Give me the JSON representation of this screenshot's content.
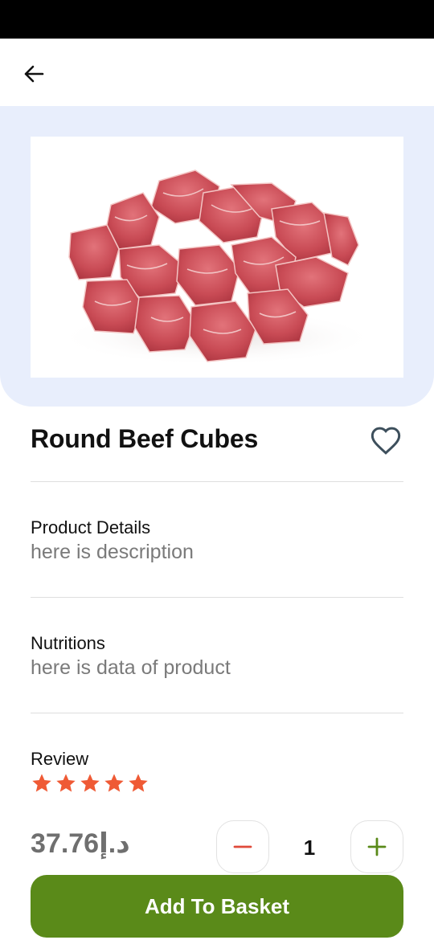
{
  "product": {
    "title": "Round Beef Cubes",
    "image_alt": "Round Beef Cubes",
    "favorited": false
  },
  "details": {
    "label": "Product Details",
    "value": "here is description"
  },
  "nutritions": {
    "label": "Nutritions",
    "value": "here is data of product"
  },
  "review": {
    "label": "Review",
    "rating": 5,
    "max_rating": 5
  },
  "price": {
    "amount": "37.76",
    "currency": "د.إ"
  },
  "quantity": {
    "value": "1"
  },
  "actions": {
    "add_to_basket": "Add To Basket"
  },
  "colors": {
    "accent": "#5a8a19",
    "hero_bg": "#e8eefc",
    "star": "#ef5a35",
    "minus": "#e04a3a",
    "plus": "#5a8a19"
  },
  "icons": {
    "back": "arrow-left-icon",
    "favorite": "heart-outline-icon",
    "star": "star-filled-icon",
    "minus": "minus-icon",
    "plus": "plus-icon"
  }
}
